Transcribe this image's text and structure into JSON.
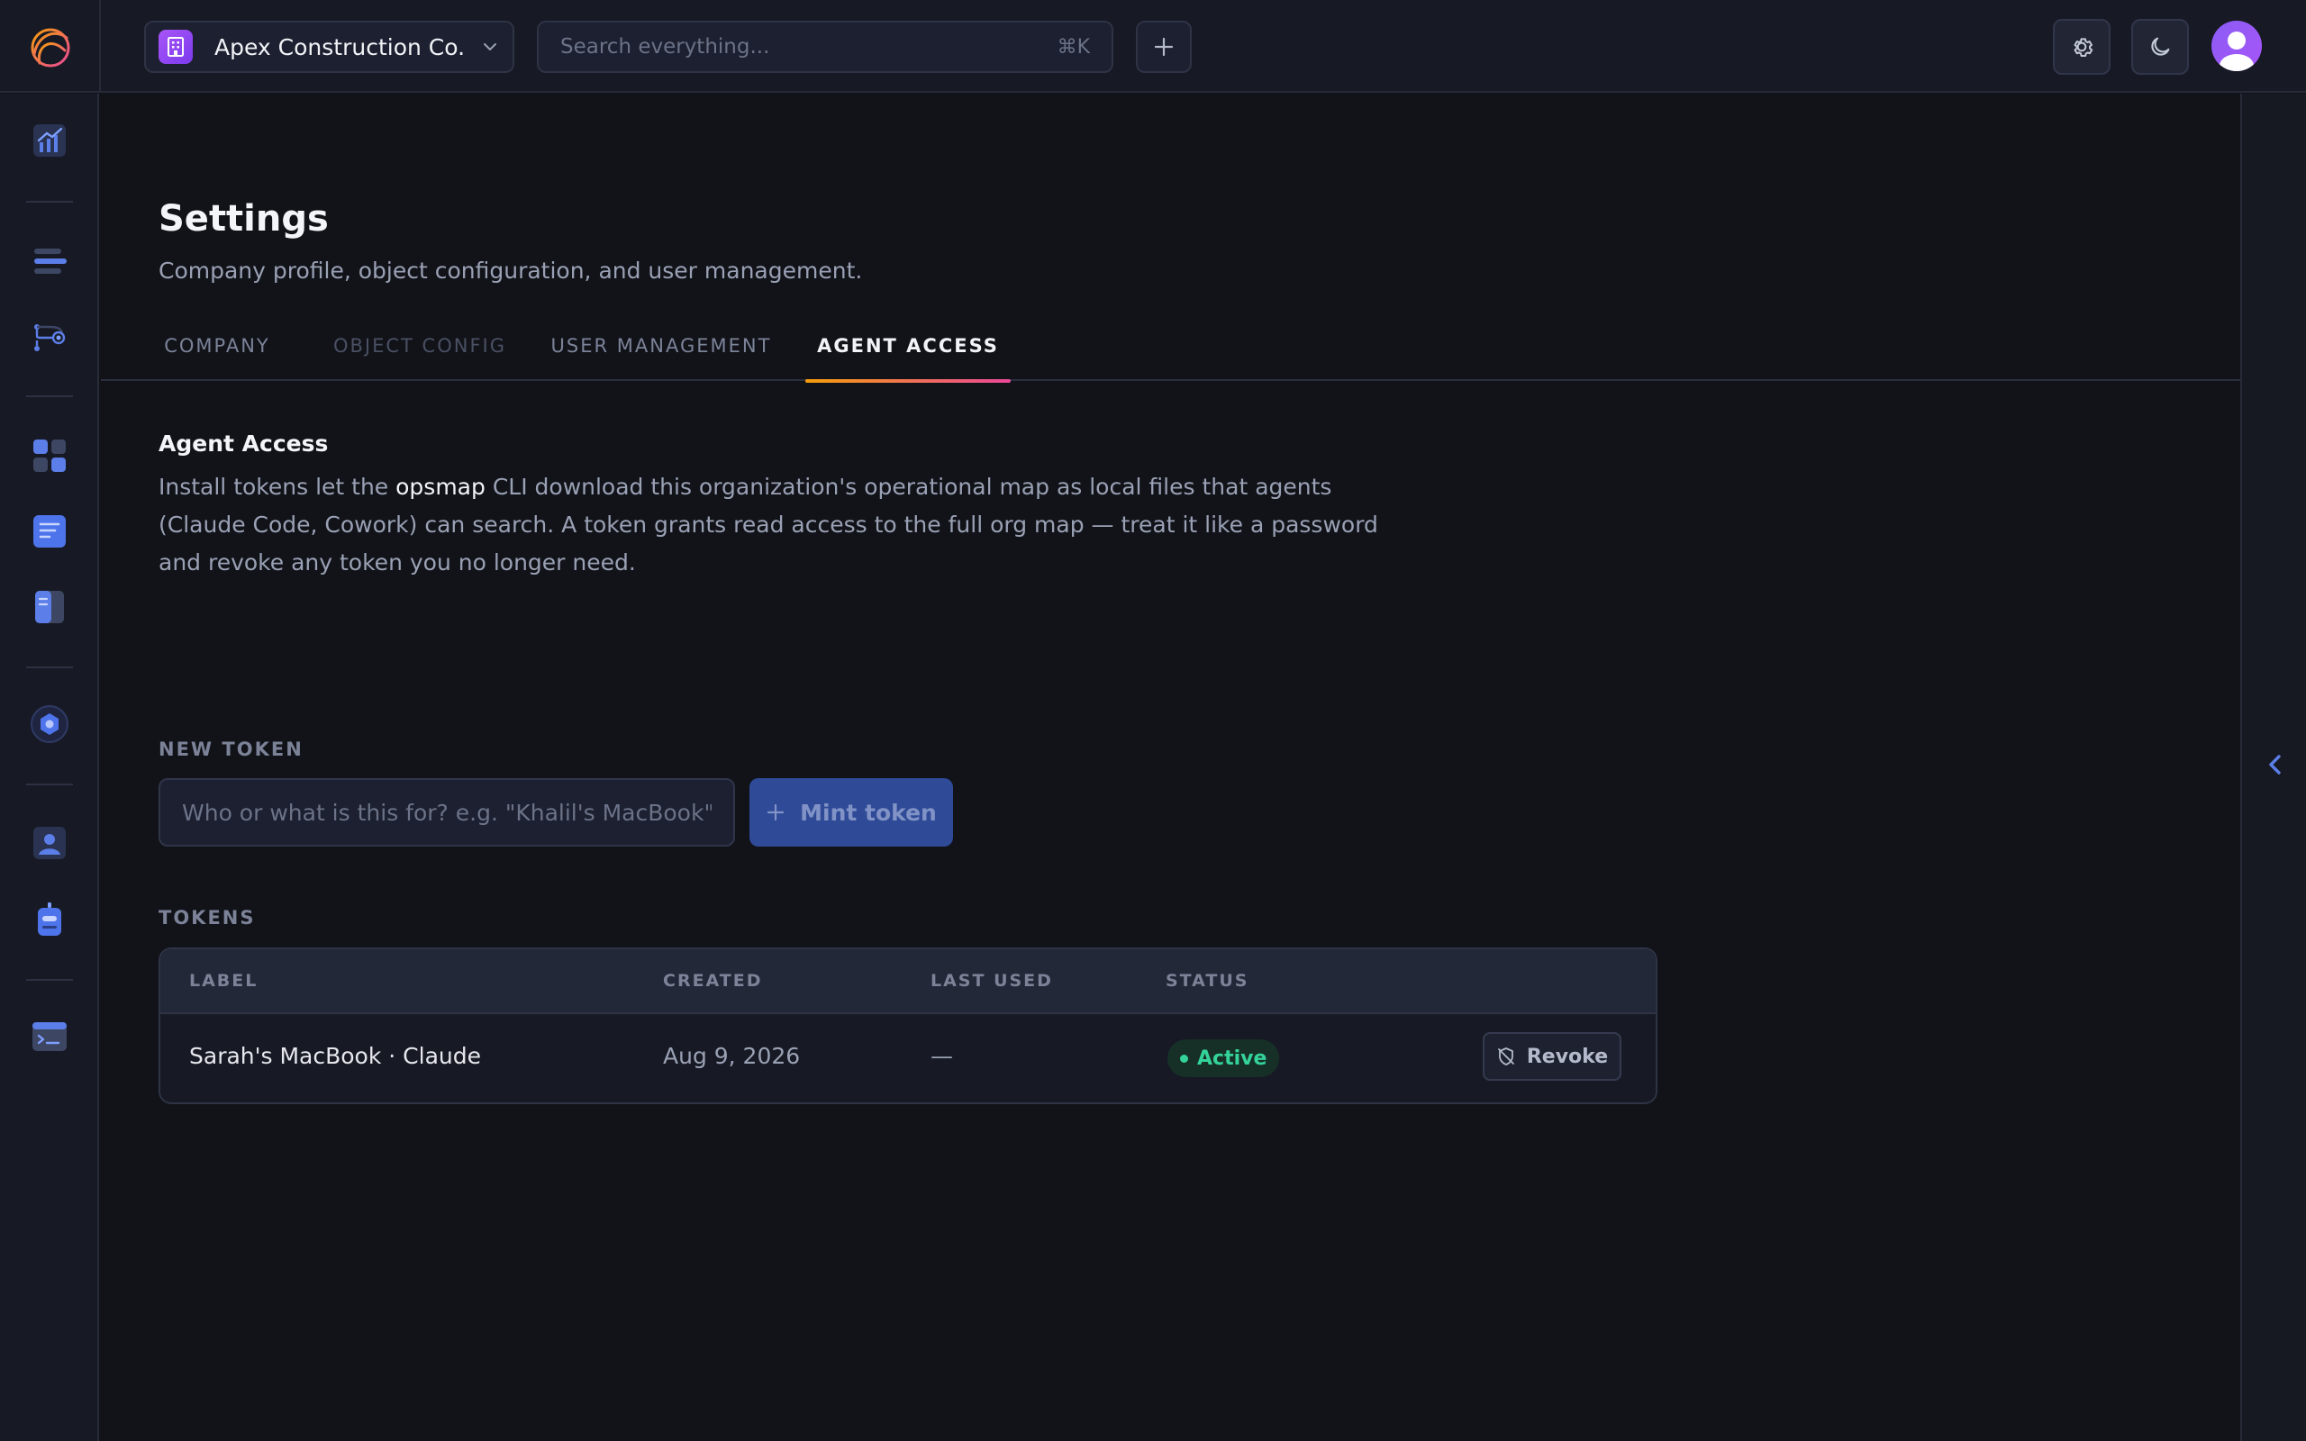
{
  "header": {
    "org_name": "Apex Construction Co.",
    "search_placeholder": "Search everything...",
    "search_shortcut": "⌘K"
  },
  "rail": {
    "items": [
      "analytics-icon",
      "list-icon",
      "workflow-icon",
      "apps-icon",
      "document-icon",
      "book-icon",
      "hex-icon",
      "user-icon",
      "robot-icon",
      "terminal-icon"
    ]
  },
  "page": {
    "title": "Settings",
    "subtitle": "Company profile, object configuration, and user management."
  },
  "tabs": [
    {
      "label": "COMPANY",
      "state": "inactive"
    },
    {
      "label": "OBJECT CONFIG",
      "state": "disabled"
    },
    {
      "label": "USER MANAGEMENT",
      "state": "inactive"
    },
    {
      "label": "AGENT ACCESS",
      "state": "active"
    }
  ],
  "agent_access": {
    "title": "Agent Access",
    "desc_before": "Install tokens let the ",
    "desc_code": "opsmap",
    "desc_after": " CLI download this organization's operational map as local files that agents (Claude Code, Cowork) can search. A token grants read access to the full org map — treat it like a password and revoke any token you no longer need.",
    "new_token_label": "NEW TOKEN",
    "input_placeholder": "Who or what is this for? e.g. \"Khalil's MacBook\"",
    "mint_label": "Mint token",
    "tokens_label": "TOKENS"
  },
  "table": {
    "columns": [
      "LABEL",
      "CREATED",
      "LAST USED",
      "STATUS"
    ],
    "rows": [
      {
        "label": "Sarah's MacBook · Claude",
        "created": "Aug 9, 2026",
        "last_used": "—",
        "status": "Active",
        "action": "Revoke"
      }
    ]
  },
  "colors": {
    "accent_tab_gradient": [
      "#f59e0b",
      "#ec4899"
    ],
    "status_active": "#34d399",
    "primary_button": "#2f4a97"
  }
}
